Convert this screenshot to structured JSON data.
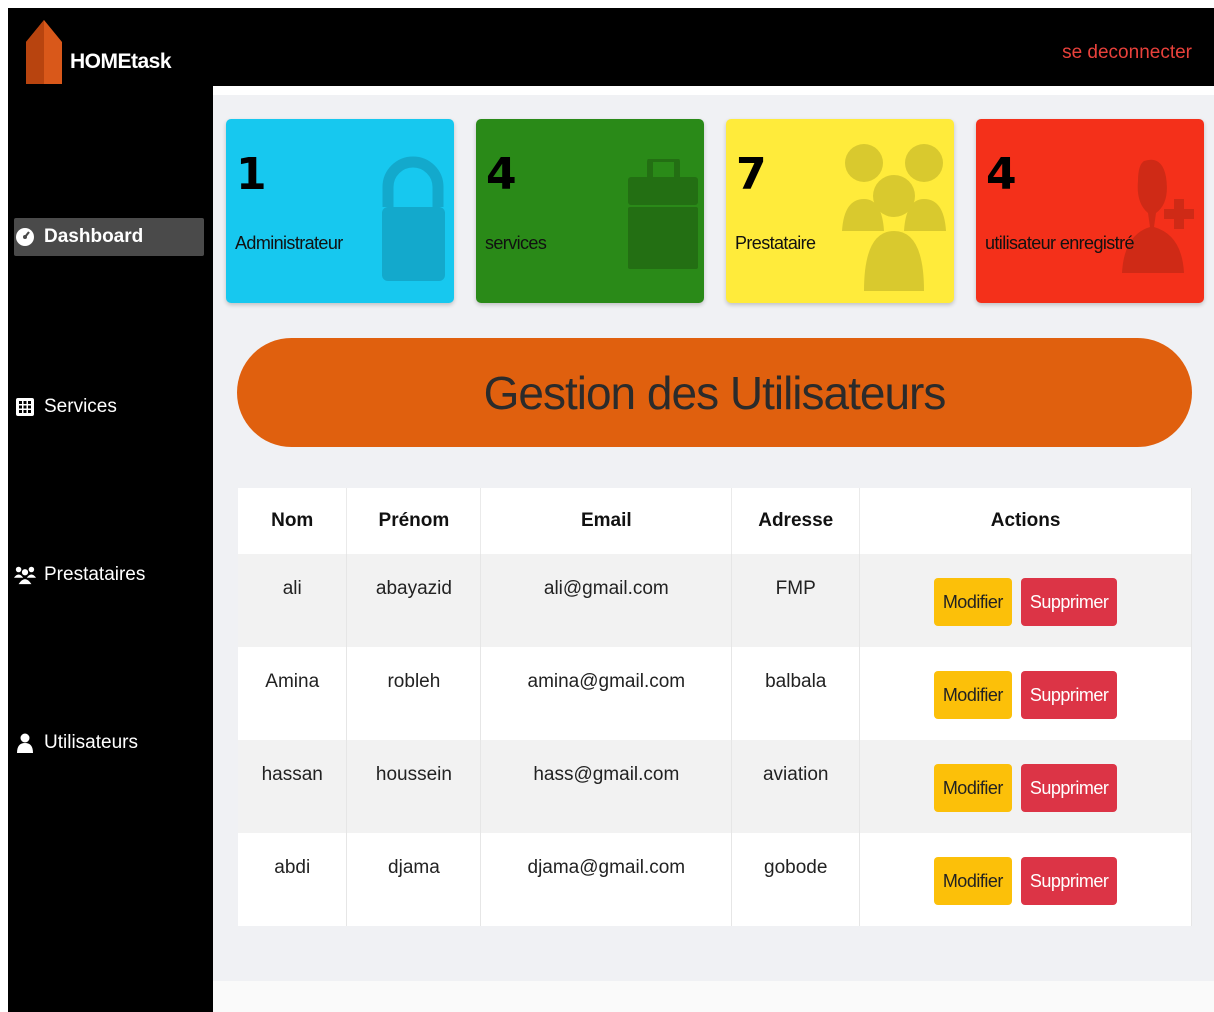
{
  "brand": {
    "name": "HOMEtask",
    "logo_color": "#d9581a"
  },
  "header": {
    "logout_label": "se deconnecter",
    "logout_color": "#e8413b"
  },
  "sidebar": {
    "items": [
      {
        "label": "Dashboard",
        "icon": "dashboard-icon",
        "active": true
      },
      {
        "label": "Services",
        "icon": "grid-icon",
        "active": false
      },
      {
        "label": "Prestataires",
        "icon": "users-icon",
        "active": false
      },
      {
        "label": "Utilisateurs",
        "icon": "user-icon",
        "active": false
      }
    ]
  },
  "cards": [
    {
      "count": "1",
      "label": "Administrateur",
      "color": "#17c8ef",
      "icon": "lock-icon"
    },
    {
      "count": "4",
      "label": "services",
      "color": "#2a8a18",
      "icon": "briefcase-icon"
    },
    {
      "count": "7",
      "label": "Prestataire",
      "color": "#ffeb3b",
      "icon": "users-group-icon"
    },
    {
      "count": "4",
      "label": "utilisateur enregistré",
      "color": "#f4301a",
      "icon": "user-add-icon"
    }
  ],
  "banner": {
    "title": "Gestion des Utilisateurs",
    "color": "#e0600e"
  },
  "table": {
    "headers": [
      "Nom",
      "Prénom",
      "Email",
      "Adresse",
      "Actions"
    ],
    "rows": [
      {
        "nom": "ali",
        "prenom": "abayazid",
        "email": "ali@gmail.com",
        "adresse": "FMP"
      },
      {
        "nom": "Amina",
        "prenom": "robleh",
        "email": "amina@gmail.com",
        "adresse": "balbala"
      },
      {
        "nom": "hassan",
        "prenom": "houssein",
        "email": "hass@gmail.com",
        "adresse": "aviation"
      },
      {
        "nom": "abdi",
        "prenom": "djama",
        "email": "djama@gmail.com",
        "adresse": "gobode"
      }
    ],
    "edit_label": "Modifier",
    "delete_label": "Supprimer"
  }
}
